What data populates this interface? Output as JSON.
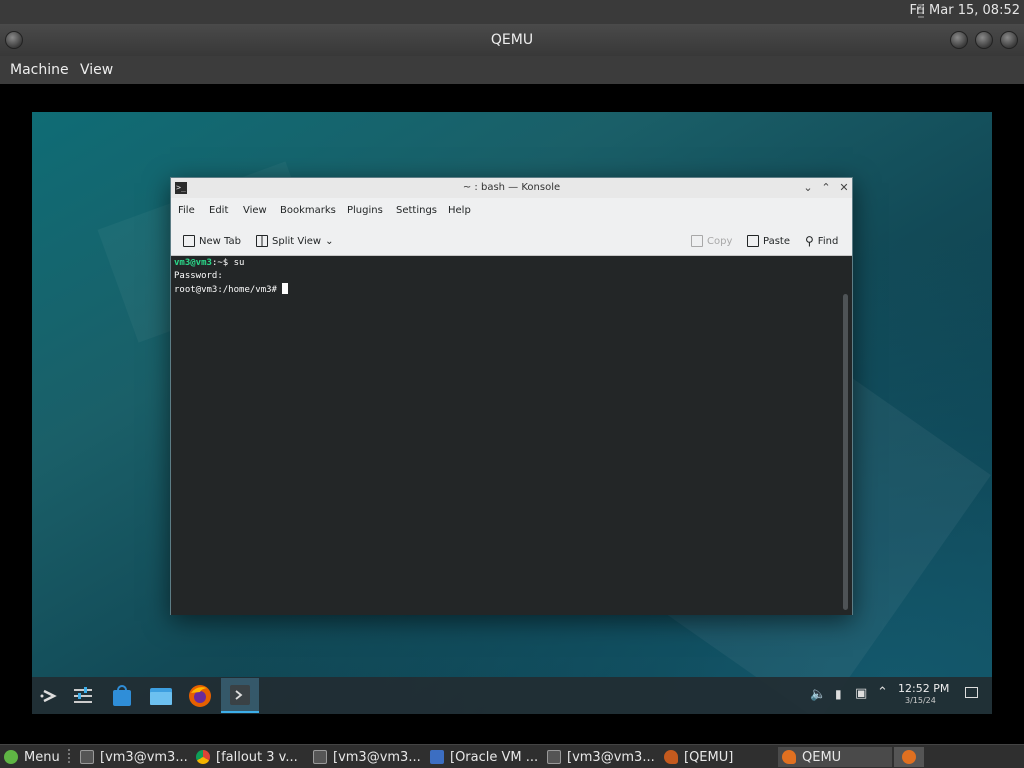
{
  "host": {
    "clock": "Fri Mar 15, 08:52",
    "window_title": "QEMU",
    "menu": [
      "Machine",
      "View"
    ]
  },
  "konsole": {
    "title": "~ : bash — Konsole",
    "menu": [
      "File",
      "Edit",
      "View",
      "Bookmarks",
      "Plugins",
      "Settings",
      "Help"
    ],
    "toolbar": {
      "new_tab": "New Tab",
      "split_view": "Split View",
      "copy": "Copy",
      "paste": "Paste",
      "find": "Find"
    },
    "terminal": {
      "line1_prompt": "vm3@vm3",
      "line1_rest": ":~$ su",
      "line2": "Password:",
      "line3": "root@vm3:/home/vm3# "
    }
  },
  "guest_panel": {
    "time": "12:52 PM",
    "date": "3/15/24"
  },
  "taskbar": {
    "menu_label": "Menu",
    "items": [
      "[vm3@vm3...",
      "[fallout 3 v...",
      "[vm3@vm3...",
      "[Oracle VM ...",
      "[vm3@vm3...",
      "[QEMU]",
      "QEMU"
    ]
  },
  "colors": {
    "accent": "#3daee9",
    "prompt_green": "#2bd98a",
    "terminal_bg": "#232627"
  }
}
